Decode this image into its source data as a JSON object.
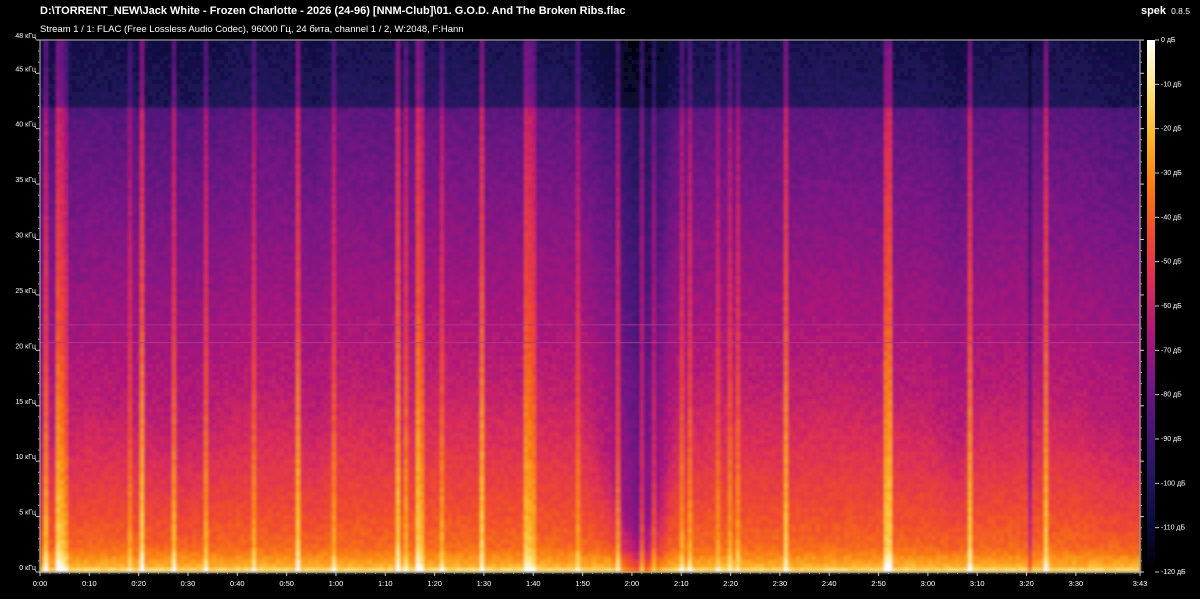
{
  "header": {
    "file_path": "D:\\TORRENT_NEW\\Jack White - Frozen Charlotte - 2026 (24-96) [NNM-Club]\\01. G.O.D. And The Broken Ribs.flac",
    "stream_info": "Stream 1 / 1: FLAC (Free Lossless Audio Codec), 96000 Гц, 24 бита, channel 1 / 2, W:2048, F:Hann"
  },
  "brand": {
    "name": "spek",
    "version": "0.8.5"
  },
  "chart_data": {
    "type": "heatmap",
    "title": "",
    "xlabel": "",
    "ylabel": "",
    "x_tick_labels": [
      "0:00",
      "0:10",
      "0:20",
      "0:30",
      "0:40",
      "0:50",
      "1:00",
      "1:10",
      "1:20",
      "1:30",
      "1:40",
      "1:50",
      "2:00",
      "2:10",
      "2:20",
      "2:30",
      "2:40",
      "2:50",
      "3:00",
      "3:10",
      "3:20",
      "3:30",
      "3:43"
    ],
    "x_range_seconds": [
      0,
      223
    ],
    "y_tick_labels": [
      "0 кГц",
      "5 кГц",
      "10 кГц",
      "15 кГц",
      "20 кГц",
      "25 кГц",
      "30 кГц",
      "35 кГц",
      "40 кГц",
      "45 кГц",
      "48 кГц"
    ],
    "y_ticks_khz": [
      0,
      5,
      10,
      15,
      20,
      25,
      30,
      35,
      40,
      45,
      48
    ],
    "y_range_khz": [
      0,
      48
    ],
    "colorbar_tick_labels": [
      "0 дБ",
      "-10 дБ",
      "-20 дБ",
      "-30 дБ",
      "-40 дБ",
      "-50 дБ",
      "-60 дБ",
      "-70 дБ",
      "-80 дБ",
      "-90 дБ",
      "-100 дБ",
      "-110 дБ",
      "-120 дБ"
    ],
    "colorbar_db": [
      0,
      -10,
      -20,
      -30,
      -40,
      -50,
      -60,
      -70,
      -80,
      -90,
      -100,
      -110,
      -120
    ],
    "colorbar_range_db": [
      -120,
      0
    ],
    "colormap": [
      "#000000",
      "#0b0b3a",
      "#24175e",
      "#4a1479",
      "#7c1584",
      "#ae1878",
      "#d92c5a",
      "#f0492e",
      "#fa7d12",
      "#fdb52a",
      "#ffe57e",
      "#ffffff"
    ],
    "horizontal_lines_khz": [
      20.7,
      22.3
    ],
    "quiet_regions_seconds": [
      [
        116,
        127
      ],
      [
        200,
        201
      ]
    ],
    "energy_profile": {
      "time_s": [
        0,
        10,
        20,
        28,
        33,
        40,
        50,
        56,
        60,
        70,
        80,
        90,
        100,
        110,
        115,
        118,
        122,
        126,
        130,
        140,
        150,
        160,
        170,
        180,
        186,
        190,
        200,
        210,
        215,
        223
      ],
      "upper_khz": [
        12,
        16,
        15,
        13,
        14,
        17,
        17,
        14,
        18,
        17,
        19,
        18,
        18,
        17,
        10,
        8,
        8,
        9,
        16,
        18,
        17,
        18,
        17,
        16,
        12,
        16,
        17,
        16,
        14,
        12
      ]
    },
    "grid": false,
    "legend": "colorbar-right"
  }
}
